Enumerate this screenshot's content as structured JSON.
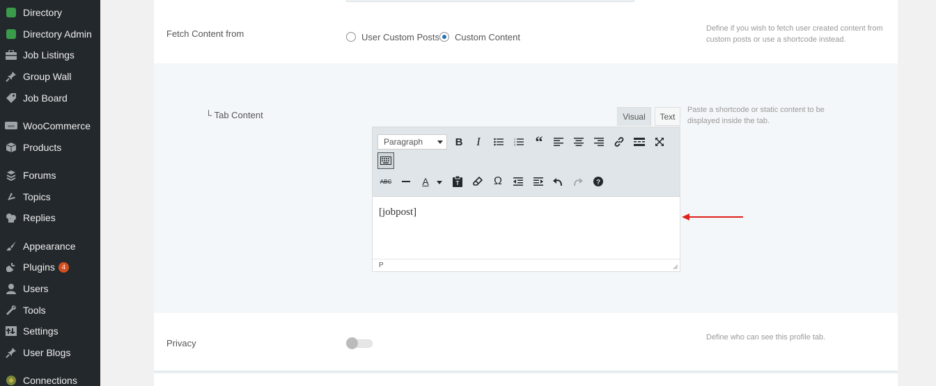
{
  "sidebar": {
    "items": [
      {
        "label": "Directory",
        "icon": "directory-icon",
        "badge": ""
      },
      {
        "label": "Directory Admin",
        "icon": "directory-admin-icon",
        "badge": ""
      },
      {
        "label": "Job Listings",
        "icon": "briefcase-icon",
        "badge": ""
      },
      {
        "label": "Group Wall",
        "icon": "pin-icon",
        "badge": ""
      },
      {
        "label": "Job Board",
        "icon": "tag-icon",
        "badge": ""
      },
      {
        "label": "WooCommerce",
        "icon": "woocommerce-icon",
        "badge": ""
      },
      {
        "label": "Products",
        "icon": "box-icon",
        "badge": ""
      },
      {
        "label": "Forums",
        "icon": "forums-icon",
        "badge": ""
      },
      {
        "label": "Topics",
        "icon": "topics-icon",
        "badge": ""
      },
      {
        "label": "Replies",
        "icon": "replies-icon",
        "badge": ""
      },
      {
        "label": "Appearance",
        "icon": "brush-icon",
        "badge": ""
      },
      {
        "label": "Plugins",
        "icon": "plug-icon",
        "badge": "4"
      },
      {
        "label": "Users",
        "icon": "user-icon",
        "badge": ""
      },
      {
        "label": "Tools",
        "icon": "wrench-icon",
        "badge": ""
      },
      {
        "label": "Settings",
        "icon": "settings-icon",
        "badge": ""
      },
      {
        "label": "User Blogs",
        "icon": "pin-icon",
        "badge": ""
      },
      {
        "label": "Connections",
        "icon": "connections-icon",
        "badge": ""
      }
    ]
  },
  "fetch": {
    "label": "Fetch Content from",
    "options": [
      "User Custom Posts",
      "Custom Content"
    ],
    "selected": "Custom Content",
    "help": "Define if you wish to fetch user created content from custom posts or use a shortcode instead."
  },
  "tab_content": {
    "label": "└ Tab Content",
    "help": "Paste a shortcode or static content to be displayed inside the tab.",
    "editor": {
      "tab_visual": "Visual",
      "tab_text": "Text",
      "format_value": "Paragraph",
      "content": "[jobpost]",
      "status_path": "P",
      "toolbar_row1": [
        "bold-icon",
        "italic-icon",
        "bullet-list-icon",
        "numbered-list-icon",
        "blockquote-icon",
        "align-left-icon",
        "align-center-icon",
        "align-right-icon",
        "link-icon",
        "read-more-icon",
        "fullscreen-icon"
      ],
      "toolbar_row2": [
        "keyboard-toggle-icon"
      ],
      "toolbar_row3": [
        "strikethrough-icon",
        "horizontal-line-icon",
        "text-color-icon",
        "paste-text-icon",
        "clear-formatting-icon",
        "special-character-icon",
        "outdent-icon",
        "indent-icon",
        "undo-icon",
        "redo-icon",
        "help-icon"
      ]
    }
  },
  "privacy": {
    "label": "Privacy",
    "help": "Define who can see this profile tab.",
    "enabled": false
  },
  "colors": {
    "sidebar_bg": "#23282d",
    "accent": "#2271b1",
    "arrow": "#e0201a",
    "badge": "#d54e21"
  }
}
